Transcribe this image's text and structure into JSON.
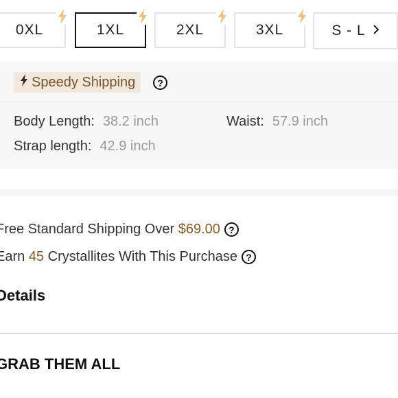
{
  "sizes": [
    {
      "label": "0XL"
    },
    {
      "label": "1XL",
      "selected": true
    },
    {
      "label": "2XL"
    },
    {
      "label": "3XL"
    },
    {
      "label": "S - L"
    }
  ],
  "speedy": {
    "badge_label": "Speedy Shipping",
    "help_icon": "question-circle-icon"
  },
  "specs": {
    "body_length_label": "Body Length:",
    "body_length_value": "38.2 inch",
    "waist_label": "Waist:",
    "waist_value": "57.9 inch",
    "strap_length_label": "Strap length:",
    "strap_length_value": "42.9 inch"
  },
  "shipping": {
    "text": "Free Standard Shipping Over",
    "amount": "$69.00"
  },
  "points": {
    "prefix": "Earn",
    "amount": "45",
    "suffix": "Crystallites With This Purchase"
  },
  "sections": {
    "details": "Details",
    "grab": "GRAB THEM ALL"
  },
  "colors": {
    "accent": "#8b5a22",
    "bolt": "#f0c078",
    "badge_bg": "#f2e8de"
  }
}
